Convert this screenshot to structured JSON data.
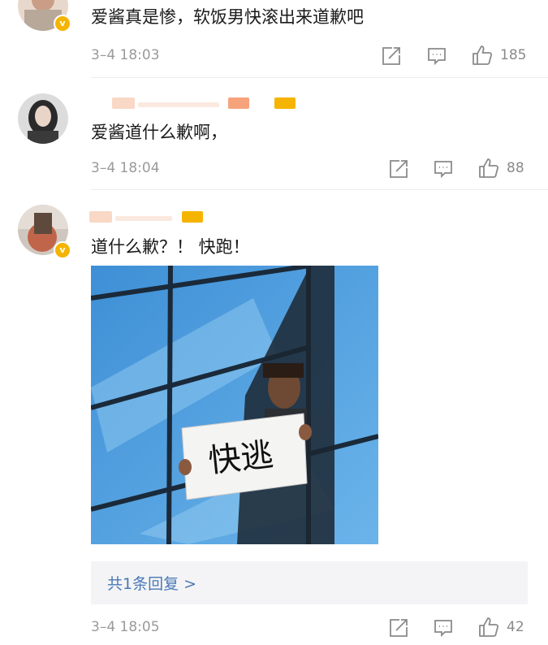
{
  "comments": [
    {
      "text": "爱酱真是惨，软饭男快滚出来道歉吧",
      "time": "3–4 18:03",
      "likes": "185"
    },
    {
      "text": "爱酱道什么歉啊，",
      "time": "3–4 18:04",
      "likes": "88"
    },
    {
      "text": "道什么歉？！ 快跑！",
      "time": "3–4 18:05",
      "likes": "42",
      "image_sign_text": "快逃",
      "reply_link": "共1条回复 >"
    }
  ],
  "icons": {
    "share": "share-icon",
    "comment": "comment-icon",
    "like": "thumbs-up-icon",
    "verified": "verified-badge-icon"
  },
  "colors": {
    "link": "#4a78b5",
    "meta": "#9a9a9a",
    "verified": "#f5b400",
    "reply_box": "#f4f4f6"
  }
}
